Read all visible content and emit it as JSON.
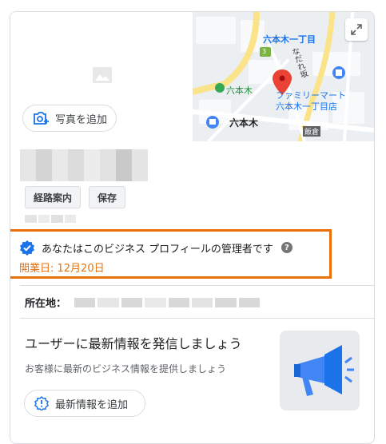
{
  "hero": {
    "add_photo_label": "写真を追加"
  },
  "map": {
    "labels": {
      "rokuhongi_1chome": "六本木一丁目",
      "rokuhongi_station": "六本木",
      "familymart": "ファミリーマート",
      "familymart_branch": "六本木一丁目店",
      "nadare": "なだれ坂",
      "iikura": "飯倉",
      "rokuhongi_area": "六本木",
      "route_num": "3"
    }
  },
  "actions": {
    "directions": "経路案内",
    "save": "保存"
  },
  "owner": {
    "message": "あなたはこのビジネス プロフィールの管理者です",
    "help": "?",
    "open_date": "開業日: 12月20日"
  },
  "address": {
    "label": "所在地："
  },
  "promo": {
    "title": "ユーザーに最新情報を発信しましょう",
    "subtitle": "お客様に最新のビジネス情報を提供しましょう",
    "button_label": "最新情報を追加"
  },
  "colors": {
    "accent": "#e8710a",
    "link": "#1a73e8",
    "pin": "#ea4335"
  }
}
